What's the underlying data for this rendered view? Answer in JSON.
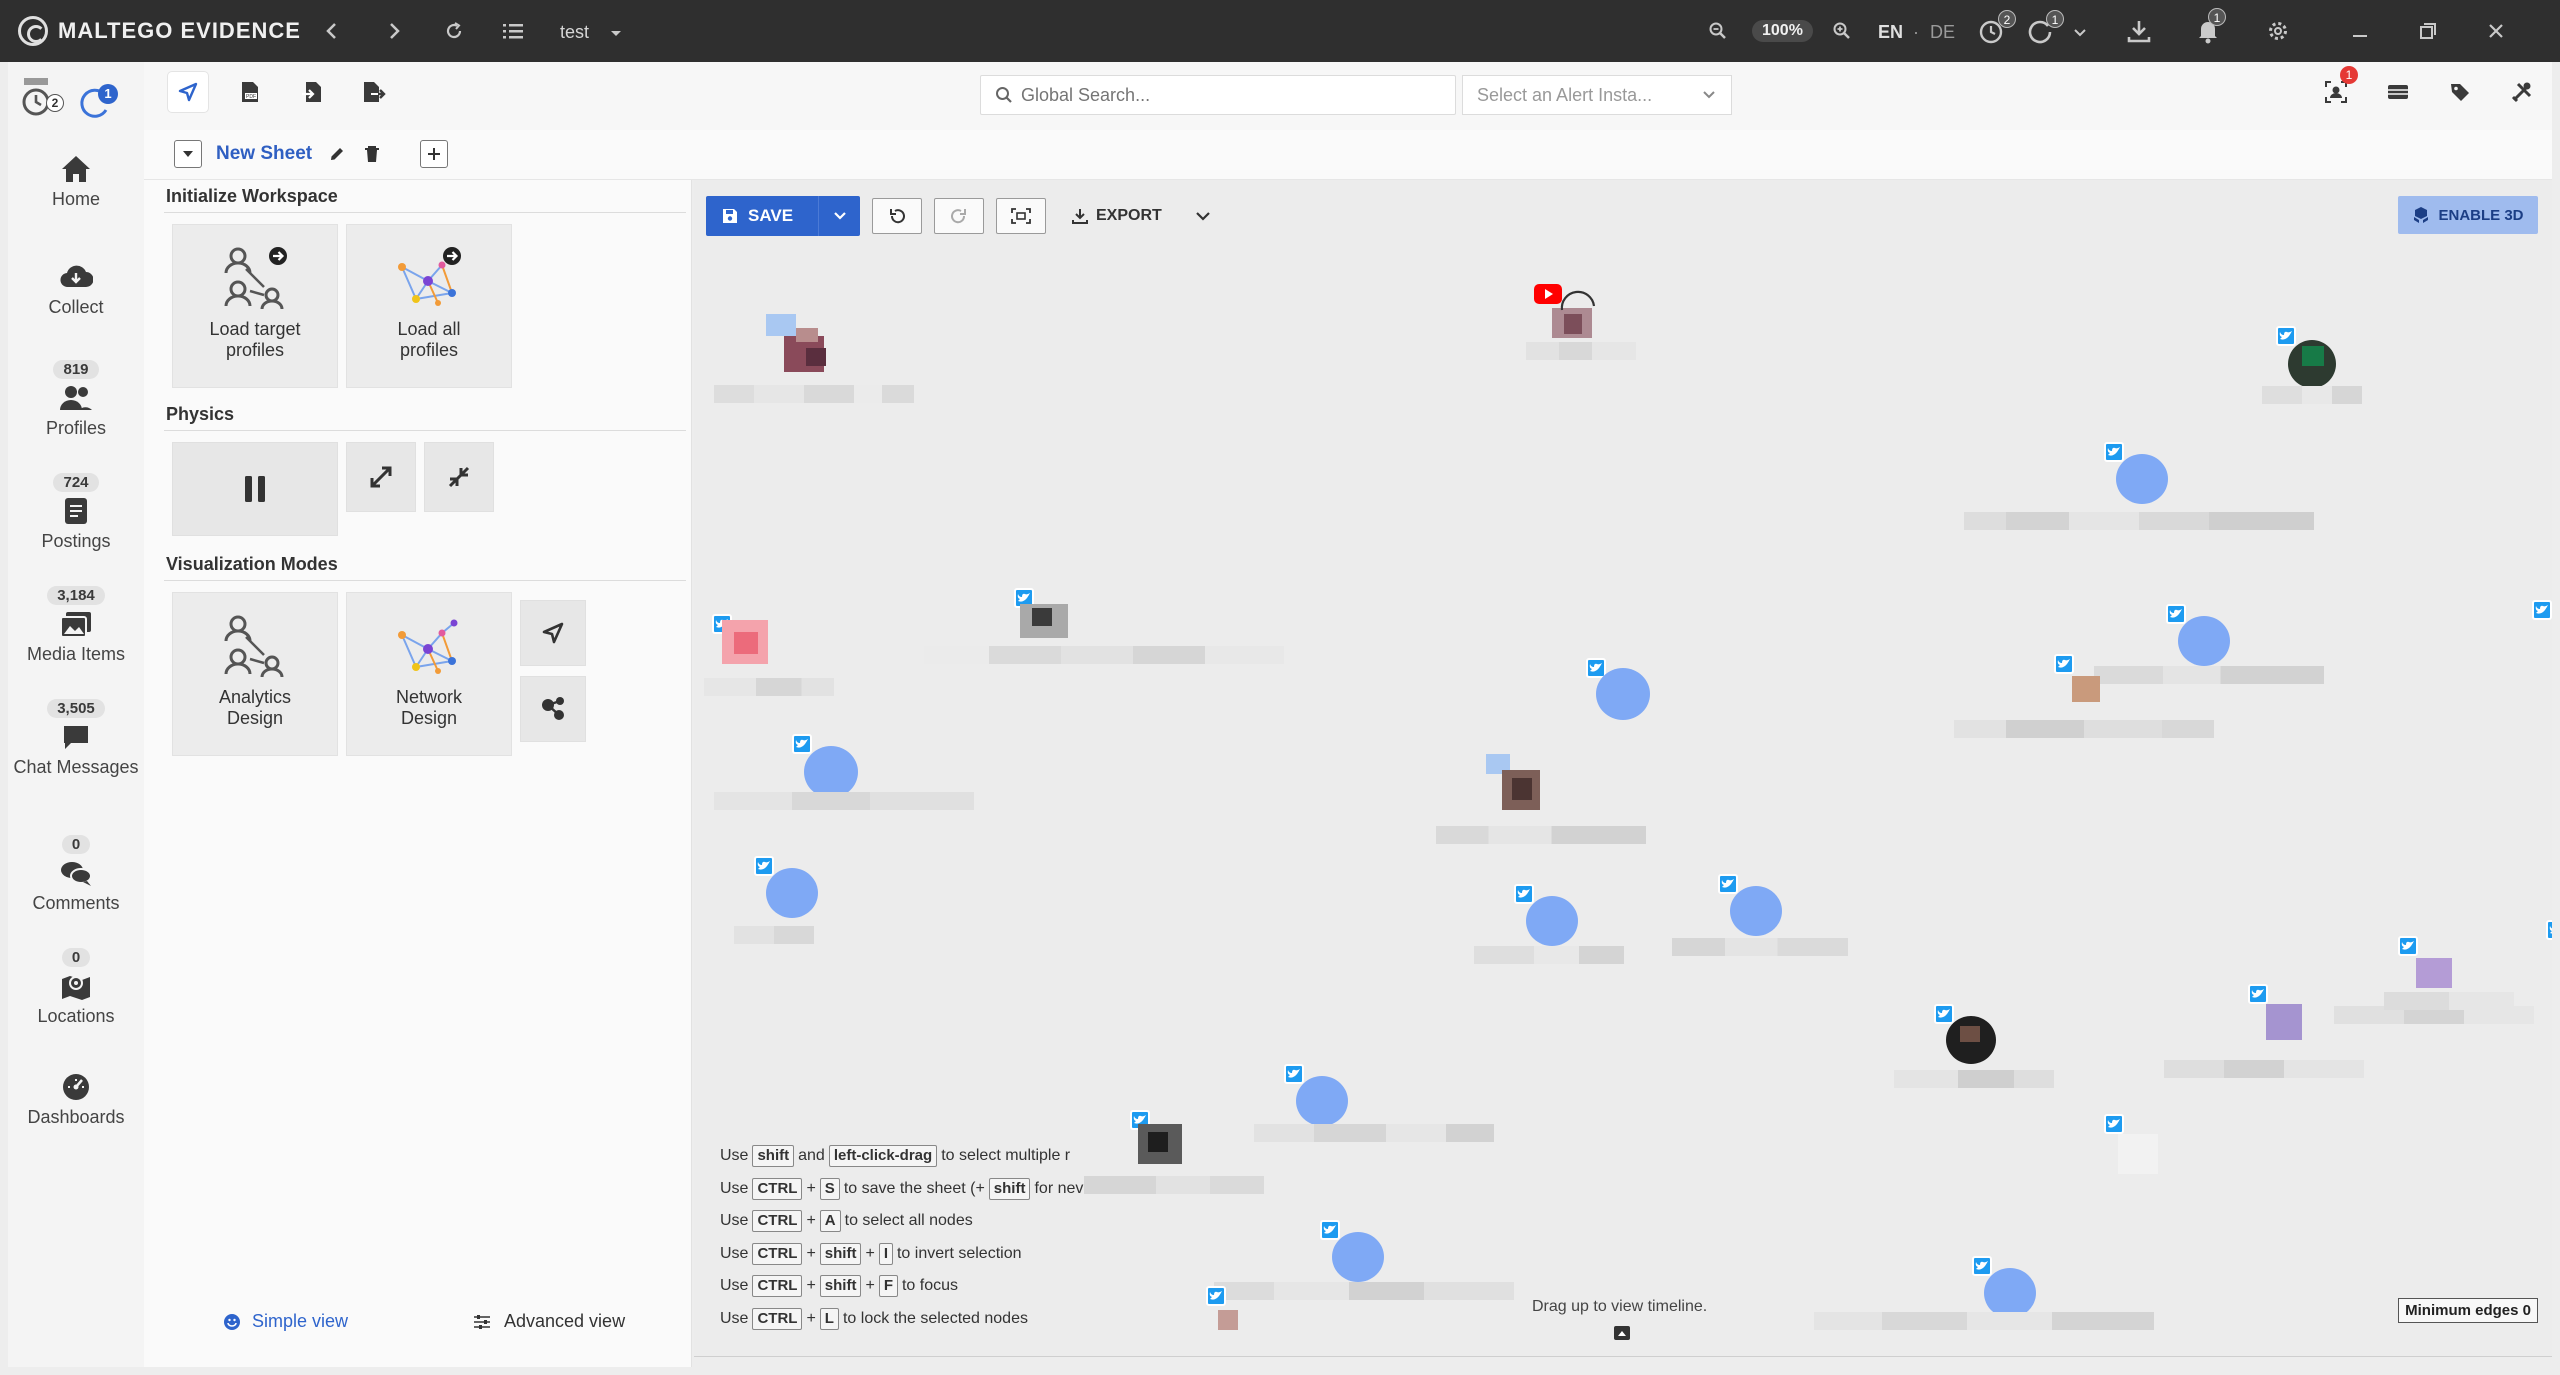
{
  "titlebar": {
    "brand": "MALTEGO EVIDENCE",
    "case_name": "test",
    "zoom": "100%",
    "lang_en": "EN",
    "lang_sep": "·",
    "lang_de": "DE",
    "history_badge": "2",
    "loading_badge": "1",
    "notifications_badge": "1"
  },
  "nav": {
    "items": [
      {
        "label": "Home",
        "count": null,
        "icon": "home-icon"
      },
      {
        "label": "Collect",
        "count": null,
        "icon": "cloud-download-icon"
      },
      {
        "label": "Profiles",
        "count": "819",
        "icon": "people-icon"
      },
      {
        "label": "Postings",
        "count": "724",
        "icon": "document-icon"
      },
      {
        "label": "Media Items",
        "count": "3,184",
        "icon": "images-icon"
      },
      {
        "label": "Chat Messages",
        "count": "3,505",
        "icon": "chat-icon"
      },
      {
        "label": "Comments",
        "count": "0",
        "icon": "comments-icon"
      },
      {
        "label": "Locations",
        "count": "0",
        "icon": "map-icon"
      },
      {
        "label": "Dashboards",
        "count": null,
        "icon": "dashboard-icon"
      }
    ],
    "history_badge": "2",
    "loading_badge": "1"
  },
  "toolbar": {
    "search_placeholder": "Global Search...",
    "alert_placeholder": "Select an Alert Insta...",
    "alert_badge": "1"
  },
  "sheet": {
    "name": "New Sheet"
  },
  "panel": {
    "init_title": "Initialize Workspace",
    "load_target": "Load target profiles",
    "load_all": "Load all profiles",
    "physics_title": "Physics",
    "viz_title": "Visualization Modes",
    "analytics": "Analytics Design",
    "network": "Network Design",
    "simple_view": "Simple view",
    "advanced_view": "Advanced view"
  },
  "canvas": {
    "save_label": "SAVE",
    "export_label": "EXPORT",
    "enable3d_label": "ENABLE 3D",
    "timeline_hint": "Drag up to view timeline.",
    "min_edges": "Minimum edges 0",
    "hints": [
      {
        "pre": "Use",
        "keys": [
          "shift"
        ],
        "mid": "and",
        "keys2": [
          "left-click-drag"
        ],
        "post": "to select multiple r"
      },
      {
        "pre": "Use",
        "keys": [
          "CTRL",
          "S"
        ],
        "post": "to save the sheet (+",
        "keys2": [
          "shift"
        ],
        "post2": "for nev"
      },
      {
        "pre": "Use",
        "keys": [
          "CTRL",
          "A"
        ],
        "post": "to select all nodes"
      },
      {
        "pre": "Use",
        "keys": [
          "CTRL",
          "shift",
          "I"
        ],
        "post": "to invert selection"
      },
      {
        "pre": "Use",
        "keys": [
          "CTRL",
          "shift",
          "F"
        ],
        "post": "to focus"
      },
      {
        "pre": "Use",
        "keys": [
          "CTRL",
          "L"
        ],
        "post": "to lock the selected nodes"
      }
    ]
  },
  "colors": {
    "accent": "#2e64cc",
    "twitter": "#1d9bf0",
    "youtube": "#ff0000",
    "enable3d_bg": "#9fbbee",
    "avatar_blue": "#7fa9f5"
  }
}
